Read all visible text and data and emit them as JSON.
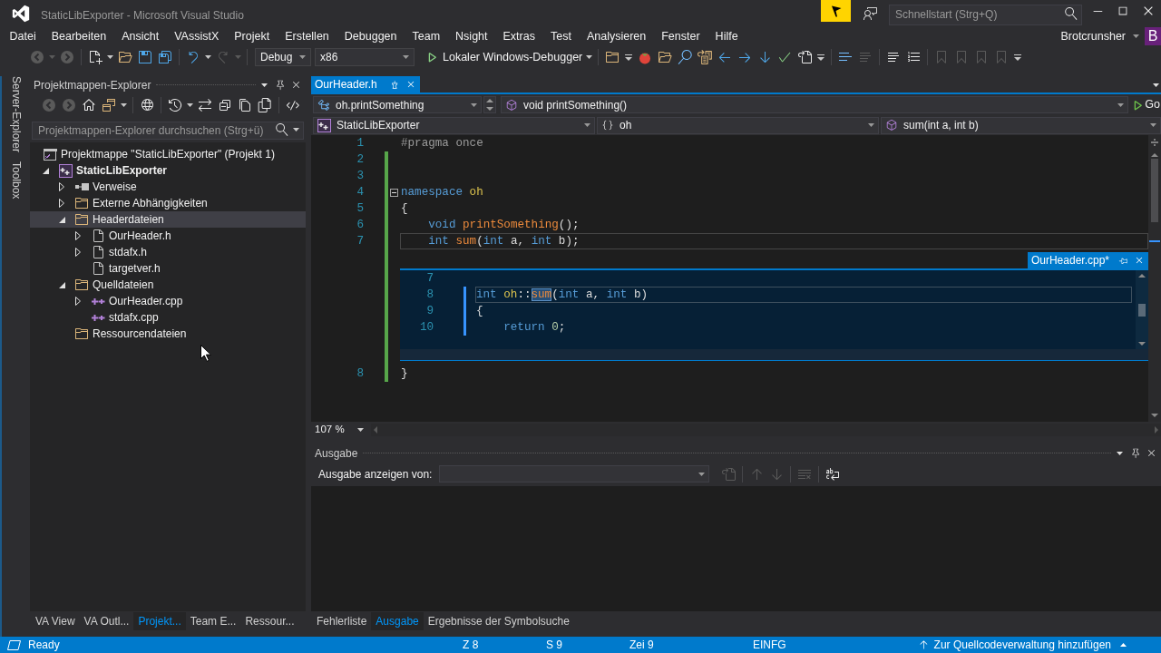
{
  "window": {
    "title": "StaticLibExporter - Microsoft Visual Studio"
  },
  "quick_launch": {
    "placeholder": "Schnellstart (Strg+Q)"
  },
  "menu": [
    "Datei",
    "Bearbeiten",
    "Ansicht",
    "VAssistX",
    "Projekt",
    "Erstellen",
    "Debuggen",
    "Team",
    "Nsight",
    "Extras",
    "Test",
    "Analysieren",
    "Fenster",
    "Hilfe"
  ],
  "account": {
    "name": "Brotcrunsher",
    "avatar": "B"
  },
  "toolbar": [
    {
      "kind": "back",
      "disabled": true
    },
    {
      "kind": "caret",
      "disabled": true
    },
    {
      "kind": "forward",
      "disabled": true
    },
    {
      "kind": "separator"
    },
    {
      "kind": "new",
      "disabled": false
    },
    {
      "kind": "caret",
      "disabled": false
    },
    {
      "kind": "open",
      "disabled": false
    },
    {
      "kind": "save",
      "disabled": false
    },
    {
      "kind": "saveall",
      "disabled": false
    },
    {
      "kind": "separator"
    },
    {
      "kind": "undo",
      "disabled": false
    },
    {
      "kind": "caret",
      "disabled": false
    },
    {
      "kind": "redo",
      "disabled": true
    },
    {
      "kind": "caret",
      "disabled": true
    },
    {
      "kind": "separator"
    },
    {
      "kind": "configuration",
      "value": "Debug"
    },
    {
      "kind": "platform",
      "value": "x86"
    },
    {
      "kind": "start",
      "label": "Lokaler Windows-Debugger"
    },
    {
      "kind": "caret",
      "disabled": false
    },
    {
      "kind": "separator"
    },
    {
      "kind": "findfiles",
      "disabled": false
    },
    {
      "kind": "overflow"
    },
    {
      "kind": "tomato",
      "disabled": false
    },
    {
      "kind": "openfile",
      "disabled": false
    },
    {
      "kind": "findsymbol",
      "disabled": false
    },
    {
      "kind": "findref",
      "disabled": false
    },
    {
      "kind": "prev",
      "disabled": false
    },
    {
      "kind": "next",
      "disabled": false
    },
    {
      "kind": "stepin",
      "disabled": false
    },
    {
      "kind": "spell",
      "disabled": false
    },
    {
      "kind": "gotofile",
      "disabled": false
    },
    {
      "kind": "overflow"
    },
    {
      "kind": "separator"
    },
    {
      "kind": "pointer",
      "disabled": false
    },
    {
      "kind": "list",
      "disabled": true
    },
    {
      "kind": "separator"
    },
    {
      "kind": "indent",
      "disabled": false
    },
    {
      "kind": "comment",
      "disabled": false
    },
    {
      "kind": "separator"
    },
    {
      "kind": "bookmark",
      "disabled": true
    },
    {
      "kind": "bookmark",
      "disabled": true
    },
    {
      "kind": "bookmark",
      "disabled": true
    },
    {
      "kind": "bookmark",
      "disabled": true
    },
    {
      "kind": "overflow"
    }
  ],
  "side_tabs": [
    "Server-Explorer",
    "Toolbox"
  ],
  "solution_explorer": {
    "title": "Projektmappen-Explorer",
    "toolbar": [
      {
        "kind": "back",
        "disabled": true
      },
      {
        "kind": "forward",
        "disabled": true
      },
      {
        "kind": "home",
        "disabled": false
      },
      {
        "kind": "views",
        "disabled": false
      },
      {
        "kind": "caret",
        "disabled": false
      },
      {
        "kind": "separator"
      },
      {
        "kind": "globe",
        "disabled": false
      },
      {
        "kind": "separator"
      },
      {
        "kind": "history",
        "disabled": false
      },
      {
        "kind": "caret",
        "disabled": false
      },
      {
        "kind": "sync",
        "disabled": false
      },
      {
        "kind": "collapse",
        "disabled": false
      },
      {
        "kind": "copy",
        "disabled": false
      },
      {
        "kind": "files",
        "disabled": false
      },
      {
        "kind": "separator"
      },
      {
        "kind": "code",
        "disabled": false
      }
    ],
    "search": {
      "placeholder": "Projektmappen-Explorer durchsuchen (Strg+ü)"
    },
    "tree": [
      {
        "label": "Projektmappe \"StaticLibExporter\" (Projekt 1)",
        "kind": "solution",
        "selected": false,
        "children": [
          {
            "label": "StaticLibExporter",
            "kind": "project",
            "selected": false,
            "expanded": true,
            "children": [
              {
                "label": "Verweise",
                "kind": "references",
                "selected": false,
                "expanded": false
              },
              {
                "label": "Externe Abhängigkeiten",
                "kind": "external",
                "selected": false,
                "expanded": false
              },
              {
                "label": "Headerdateien",
                "kind": "folder",
                "selected": true,
                "expanded": true,
                "children": [
                  {
                    "label": "OurHeader.h",
                    "kind": "header",
                    "selected": false,
                    "expanded": false
                  },
                  {
                    "label": "stdafx.h",
                    "kind": "header",
                    "selected": false,
                    "expanded": false
                  },
                  {
                    "label": "targetver.h",
                    "kind": "header",
                    "selected": false
                  }
                ]
              },
              {
                "label": "Quelldateien",
                "kind": "folder",
                "selected": false,
                "expanded": true,
                "children": [
                  {
                    "label": "OurHeader.cpp",
                    "kind": "source",
                    "selected": false,
                    "expanded": false
                  },
                  {
                    "label": "stdafx.cpp",
                    "kind": "source",
                    "selected": false
                  }
                ]
              },
              {
                "label": "Ressourcendateien",
                "kind": "folder",
                "selected": false
              }
            ]
          }
        ]
      }
    ]
  },
  "left_tabs": [
    {
      "label": "VA View",
      "selected": false
    },
    {
      "label": "VA Outl...",
      "selected": false
    },
    {
      "label": "Projekt...",
      "selected": true
    },
    {
      "label": "Team E...",
      "selected": false
    },
    {
      "label": "Ressour...",
      "selected": false
    }
  ],
  "editor": {
    "tabs": [
      {
        "label": "OurHeader.h",
        "selected": true
      }
    ],
    "navigation": {
      "scope": "oh.printSomething",
      "member": "void printSomething()",
      "go": "Go",
      "project": "StaticLibExporter",
      "namespace": "oh",
      "function": "sum(int a, int b)"
    },
    "lines": [
      {
        "number": "1",
        "changed": false,
        "current": false,
        "tokens": [
          {
            "text": "#pragma once",
            "kind": "preprocessor"
          }
        ]
      },
      {
        "number": "2",
        "changed": true,
        "current": false
      },
      {
        "number": "3",
        "changed": true,
        "current": false
      },
      {
        "number": "4",
        "changed": true,
        "current": false,
        "outline_expanded": true,
        "tokens": [
          {
            "text": "namespace",
            "kind": "keyword"
          },
          {
            "text": " oh",
            "kind": "namespace"
          }
        ]
      },
      {
        "number": "5",
        "changed": true,
        "current": false,
        "tokens": [
          {
            "text": "{",
            "kind": "plain"
          }
        ]
      },
      {
        "number": "6",
        "changed": true,
        "current": false,
        "tokens": [
          {
            "text": "    void",
            "kind": "keyword"
          },
          {
            "text": " printSomething",
            "kind": "function"
          },
          {
            "text": "();",
            "kind": "plain"
          }
        ]
      },
      {
        "number": "7",
        "changed": true,
        "current": true,
        "tokens": [
          {
            "text": "    int",
            "kind": "keyword"
          },
          {
            "text": " sum",
            "kind": "function"
          },
          {
            "text": "(",
            "kind": "plain"
          },
          {
            "text": "int",
            "kind": "keyword"
          },
          {
            "text": " a, ",
            "kind": "plain"
          },
          {
            "text": "int",
            "kind": "keyword"
          },
          {
            "text": " b);",
            "kind": "plain"
          }
        ]
      }
    ],
    "peek": {
      "file": "OurHeader.cpp*",
      "lines": [
        {
          "number": "7",
          "changed": false,
          "current": false
        },
        {
          "number": "8",
          "changed": true,
          "current": true,
          "tokens": [
            {
              "text": "int",
              "kind": "keyword",
              "selected": false
            },
            {
              "text": " oh",
              "kind": "namespace",
              "selected": false
            },
            {
              "text": "::",
              "kind": "plain",
              "selected": false
            },
            {
              "text": "sum",
              "kind": "function",
              "selected": true
            },
            {
              "text": "(",
              "kind": "plain",
              "selected": false
            },
            {
              "text": "int",
              "kind": "keyword",
              "selected": false
            },
            {
              "text": " a, ",
              "kind": "plain",
              "selected": false
            },
            {
              "text": "int",
              "kind": "keyword",
              "selected": false
            },
            {
              "text": " b)",
              "kind": "plain",
              "selected": false
            }
          ]
        },
        {
          "number": "9",
          "changed": true,
          "current": false,
          "tokens": [
            {
              "text": "{",
              "kind": "plain"
            }
          ]
        },
        {
          "number": "10",
          "changed": true,
          "current": false,
          "tokens": [
            {
              "text": "    return",
              "kind": "keyword"
            },
            {
              "text": " 0",
              "kind": "number"
            },
            {
              "text": ";",
              "kind": "plain"
            }
          ]
        }
      ]
    },
    "lines_after": [
      {
        "number": "8",
        "changed": true,
        "current": false,
        "tokens": [
          {
            "text": "}",
            "kind": "plain"
          }
        ]
      }
    ],
    "zoom": "107 %"
  },
  "output": {
    "title": "Ausgabe",
    "source_label": "Ausgabe anzeigen von:",
    "toolbar": [
      {
        "kind": "goto",
        "disabled": true
      },
      {
        "kind": "separator"
      },
      {
        "kind": "up",
        "disabled": true
      },
      {
        "kind": "down",
        "disabled": true
      },
      {
        "kind": "separator"
      },
      {
        "kind": "clear",
        "disabled": true
      },
      {
        "kind": "separator"
      },
      {
        "kind": "wrap",
        "disabled": false
      }
    ]
  },
  "bottom_tabs": [
    {
      "label": "Fehlerliste",
      "selected": false
    },
    {
      "label": "Ausgabe",
      "selected": true
    },
    {
      "label": "Ergebnisse der Symbolsuche",
      "selected": false
    }
  ],
  "status_bar": {
    "state": "Ready",
    "line": "Z 8",
    "column": "S 9",
    "char": "Zei 9",
    "mode": "EINFG",
    "source_control": "Zur Quellcodeverwaltung hinzufügen"
  }
}
